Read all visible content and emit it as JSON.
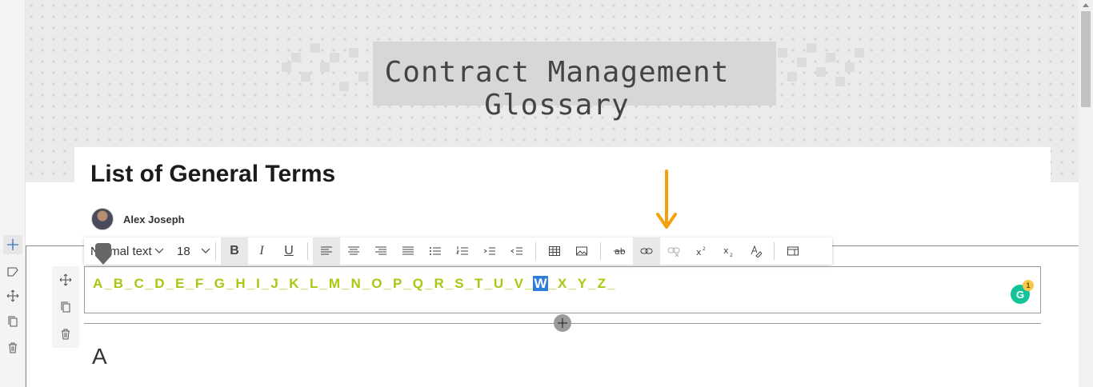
{
  "banner": {
    "title": "Contract Management Glossary"
  },
  "page": {
    "title": "List of General Terms"
  },
  "author": {
    "name": "Alex Joseph"
  },
  "toolbar": {
    "style_value": "Normal text",
    "size_value": "18",
    "bold_label": "B",
    "italic_label": "I",
    "underline_label": "U"
  },
  "alphabet": [
    "A",
    "B",
    "C",
    "D",
    "E",
    "F",
    "G",
    "H",
    "I",
    "J",
    "K",
    "L",
    "M",
    "N",
    "O",
    "P",
    "Q",
    "R",
    "S",
    "T",
    "U",
    "V",
    "W",
    "X",
    "Y",
    "Z"
  ],
  "selected_letter": "W",
  "letter_separator": "_",
  "grammarly": {
    "label": "G",
    "count": "1"
  },
  "section": {
    "heading": "A"
  },
  "colors": {
    "letters": "#a8c911",
    "selection": "#2f7bd8",
    "arrow": "#f2a20c",
    "grammarly": "#15c39a"
  },
  "icons": [
    "plus-icon",
    "edit-icon",
    "move-icon",
    "copy-icon",
    "trash-icon",
    "bold-icon",
    "italic-icon",
    "underline-icon",
    "align-left-icon",
    "align-center-icon",
    "align-right-icon",
    "justify-icon",
    "bullets-icon",
    "numbering-icon",
    "indent-icon",
    "outdent-icon",
    "table-icon",
    "image-icon",
    "strikethrough-icon",
    "link-icon",
    "unlink-icon",
    "superscript-icon",
    "subscript-icon",
    "clear-format-icon",
    "pane-icon"
  ]
}
